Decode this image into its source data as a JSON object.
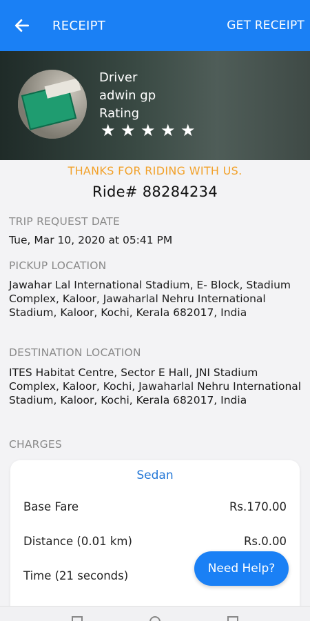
{
  "header": {
    "title": "RECEIPT",
    "action": "GET RECEIPT"
  },
  "driver": {
    "label": "Driver",
    "name": "adwin gp",
    "rating_label": "Rating",
    "rating": 5,
    "rating_max": 5
  },
  "thanks": "THANKS FOR RIDING WITH US.",
  "ride": "Ride# 88284234",
  "trip": {
    "date_label": "TRIP REQUEST DATE",
    "date_value": "Tue, Mar 10, 2020 at 05:41 PM",
    "pickup_label": "PICKUP LOCATION",
    "pickup_value": "Jawahar Lal International Stadium, E- Block, Stadium Complex, Kaloor, Jawaharlal Nehru International Stadium, Kaloor, Kochi, Kerala 682017, India",
    "destination_label": "DESTINATION LOCATION",
    "destination_value": "ITES Habitat Centre, Sector E Hall, JNI Stadium Complex, Kaloor, Kochi, Jawaharlal Nehru International Stadium, Kaloor, Kochi, Kerala 682017, India",
    "charges_label": "CHARGES"
  },
  "charges": {
    "vehicle": "Sedan",
    "rows": [
      {
        "label": "Base Fare",
        "value": "Rs.170.00"
      },
      {
        "label": "Distance (0.01 km)",
        "value": "Rs.0.00"
      },
      {
        "label": "Time (21 seconds)",
        "value": ""
      }
    ]
  },
  "help_button": "Need Help?",
  "colors": {
    "primary": "#1a80f5",
    "accent": "#f2a12a",
    "link": "#2276d6"
  }
}
